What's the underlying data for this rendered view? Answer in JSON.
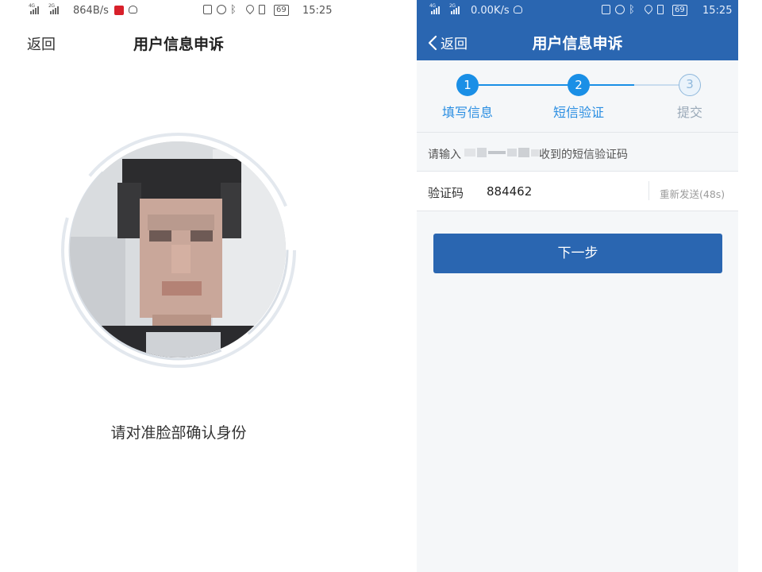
{
  "left": {
    "status": {
      "net1": "4G",
      "net2": "2G",
      "speed": "864B/s",
      "battery": "69",
      "time": "15:25"
    },
    "back_label": "返回",
    "title": "用户信息申诉",
    "face_hint": "请对准脸部确认身份"
  },
  "right": {
    "status": {
      "net1": "4G",
      "net2": "2G",
      "speed": "0.00K/s",
      "battery": "69",
      "time": "15:25"
    },
    "back_label": "返回",
    "title": "用户信息申诉",
    "steps": [
      {
        "num": "1",
        "label": "填写信息",
        "state": "done"
      },
      {
        "num": "2",
        "label": "短信验证",
        "state": "current"
      },
      {
        "num": "3",
        "label": "提交",
        "state": "todo"
      }
    ],
    "sms_hint_prefix": "请输入",
    "sms_hint_suffix": "收到的短信验证码",
    "code_label": "验证码",
    "code_value": "884462",
    "resend_label": "重新发送(48s)",
    "next_label": "下一步"
  },
  "colors": {
    "brand_blue": "#2a66b1",
    "step_blue": "#1a8fe6",
    "step_inactive": "#8fb8dc"
  },
  "icons": [
    "signal-icon",
    "nfc-icon",
    "alarm-icon",
    "bluetooth-icon",
    "location-icon",
    "vibrate-icon",
    "battery-icon",
    "back-arrow-icon"
  ]
}
